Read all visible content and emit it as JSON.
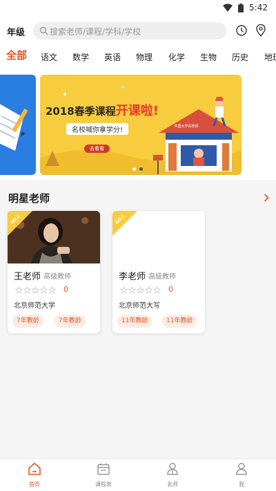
{
  "status_bar": {
    "time": "5:42"
  },
  "header": {
    "grade_label": "年级",
    "search_placeholder": "搜索老师/课程/学科/学校",
    "clock_icon": "clock-icon",
    "location_icon": "location-pin-icon"
  },
  "tabs": [
    {
      "label": "全部",
      "active": true
    },
    {
      "label": "语文"
    },
    {
      "label": "数学"
    },
    {
      "label": "英语"
    },
    {
      "label": "物理"
    },
    {
      "label": "化学"
    },
    {
      "label": "生物"
    },
    {
      "label": "历史"
    },
    {
      "label": "地理"
    }
  ],
  "banner": {
    "title_part1": "2018春季课程",
    "title_part2": "开课啦!",
    "subtitle": "名校喊你拿学分!",
    "button_label": "去看看",
    "building_sign": "中国大学先修课",
    "slide_count": 2,
    "active_slide": 2,
    "colors": {
      "main_bg": "#f7cc3e",
      "left_bg": "#2a7de1",
      "accent_red": "#d23a26"
    }
  },
  "section": {
    "title": "明星老师"
  },
  "teachers": [
    {
      "rank": "NO.1",
      "name": "王老师",
      "level": "高级教师",
      "stars": 0,
      "rating": "0",
      "school": "北京师范大学",
      "tags": [
        "7年教龄",
        "7年教龄"
      ]
    },
    {
      "rank": "NO.2",
      "name": "李老师",
      "level": "高级教师",
      "stars": 0,
      "rating": "0",
      "school": "北京师范大写",
      "tags": [
        "11年教龄",
        "11年教龄"
      ]
    }
  ],
  "nav": [
    {
      "label": "首页",
      "icon": "home-icon",
      "active": true
    },
    {
      "label": "课程表",
      "icon": "calendar-icon"
    },
    {
      "label": "名师",
      "icon": "teacher-icon"
    },
    {
      "label": "我",
      "icon": "profile-icon"
    }
  ],
  "colors": {
    "accent": "#e8541e",
    "tag_bg": "#fdebe3",
    "ribbon": "#f7cc3e"
  }
}
